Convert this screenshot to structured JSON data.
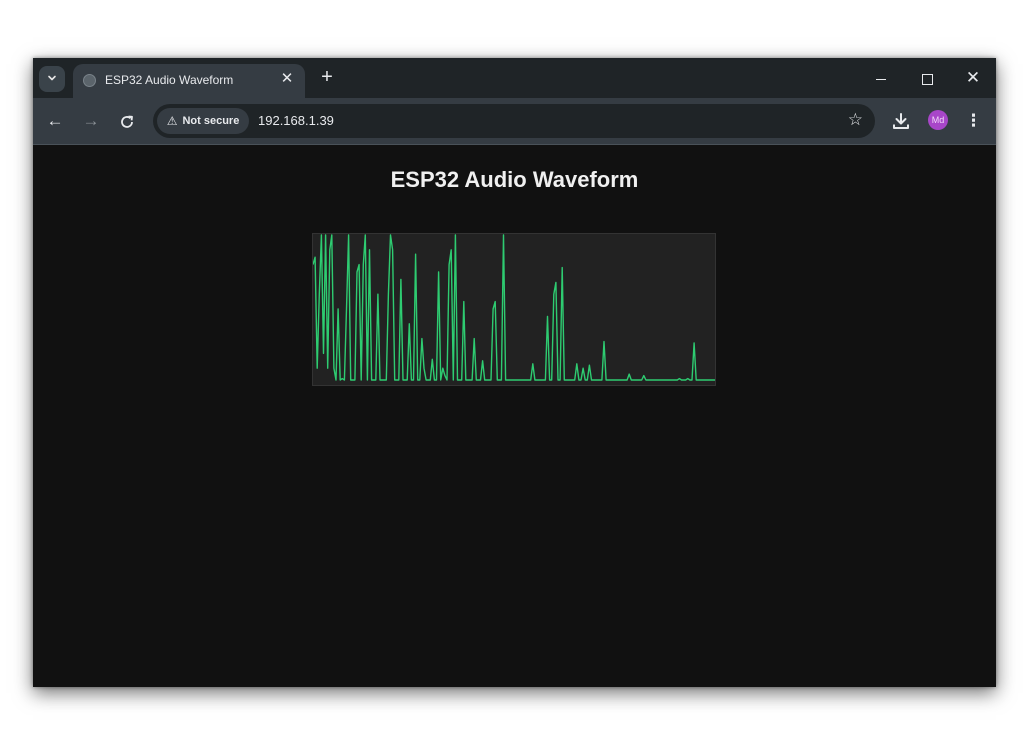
{
  "browser": {
    "tab": {
      "title": "ESP32 Audio Waveform",
      "close_glyph": "✕"
    },
    "new_tab_glyph": "+",
    "window_controls": {
      "minimize": "minimize-icon",
      "maximize": "maximize-icon",
      "close_glyph": "✕"
    },
    "nav": {
      "back_glyph": "←",
      "forward_glyph": "→",
      "reload_glyph": "↻"
    },
    "omnibox": {
      "security_label": "Not secure",
      "warning_glyph": "⚠",
      "url": "192.168.1.39",
      "bookmark_glyph": "☆"
    },
    "profile_initials": "Md",
    "menu_glyph": "⋮"
  },
  "page": {
    "title": "ESP32 Audio Waveform"
  },
  "colors": {
    "page_background": "#111111",
    "waveform_background": "#222222",
    "waveform_line": "#2ecc71",
    "avatar": "#a846c9"
  },
  "waveform": {
    "samples": [
      0.8,
      0.85,
      0.1,
      0.6,
      1,
      0.2,
      1,
      0.1,
      0.9,
      1,
      0.1,
      0.02,
      0.5,
      0.02,
      0.03,
      0.02,
      0.5,
      1,
      0.02,
      0.02,
      0.02,
      0.75,
      0.8,
      0.02,
      0.8,
      1,
      0.02,
      0.9,
      0.02,
      0.02,
      0.02,
      0.6,
      0.02,
      0.02,
      0.02,
      0.02,
      0.6,
      1,
      0.9,
      0.02,
      0.02,
      0.02,
      0.7,
      0.02,
      0.02,
      0.02,
      0.4,
      0.02,
      0.02,
      0.87,
      0.02,
      0.02,
      0.3,
      0.1,
      0.02,
      0.02,
      0.02,
      0.16,
      0.02,
      0.02,
      0.75,
      0.02,
      0.1,
      0.05,
      0.02,
      0.8,
      0.9,
      0.02,
      1,
      0.02,
      0.02,
      0.02,
      0.55,
      0.02,
      0.02,
      0.02,
      0.02,
      0.3,
      0.02,
      0.02,
      0.02,
      0.15,
      0.02,
      0.02,
      0.02,
      0.02,
      0.5,
      0.55,
      0.02,
      0.02,
      0.02,
      1,
      0.02,
      0.02,
      0.02,
      0.02,
      0.02,
      0.02,
      0.02,
      0.02,
      0.02,
      0.02,
      0.02,
      0.02,
      0.02,
      0.13,
      0.02,
      0.02,
      0.02,
      0.02,
      0.02,
      0.02,
      0.45,
      0.02,
      0.02,
      0.6,
      0.68,
      0.02,
      0.02,
      0.78,
      0.02,
      0.02,
      0.02,
      0.02,
      0.02,
      0.02,
      0.13,
      0.02,
      0.02,
      0.1,
      0.02,
      0.02,
      0.12,
      0.02,
      0.02,
      0.02,
      0.02,
      0.02,
      0.02,
      0.28,
      0.02,
      0.02,
      0.02,
      0.02,
      0.02,
      0.02,
      0.02,
      0.02,
      0.02,
      0.02,
      0.02,
      0.06,
      0.02,
      0.02,
      0.02,
      0.02,
      0.02,
      0.02,
      0.05,
      0.02,
      0.02,
      0.02,
      0.02,
      0.02,
      0.02,
      0.02,
      0.02,
      0.02,
      0.02,
      0.02,
      0.02,
      0.02,
      0.02,
      0.02,
      0.02,
      0.03,
      0.02,
      0.02,
      0.02,
      0.03,
      0.02,
      0.02,
      0.27,
      0.02,
      0.02,
      0.02,
      0.02,
      0.02,
      0.02,
      0.02,
      0.02,
      0.02,
      0.02
    ]
  }
}
